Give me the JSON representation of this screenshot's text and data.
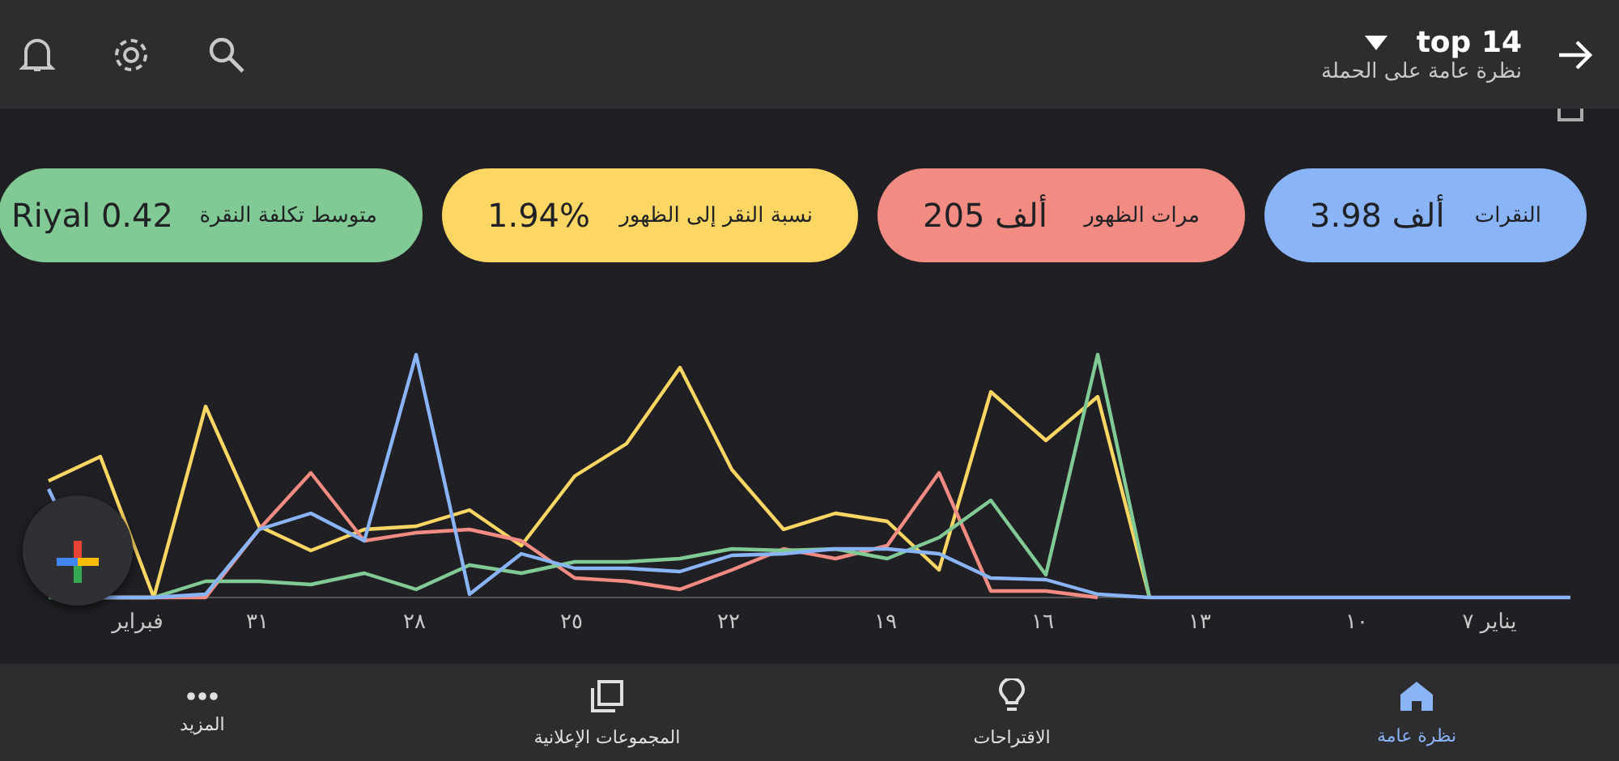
{
  "header": {
    "title": "top 14",
    "subtitle": "نظرة عامة على الحملة"
  },
  "metrics": [
    {
      "label": "النقرات",
      "value": "3.98 ألف",
      "color": "#8ab4f8"
    },
    {
      "label": "مرات الظهور",
      "value": "205 ألف",
      "color": "#f28b82"
    },
    {
      "label": "نسبة النقر إلى الظهور",
      "value": "1.94%",
      "color": "#fdd663"
    },
    {
      "label": "متوسط تكلفة النقرة",
      "value": "Riyal 0.42",
      "color": "#81c995"
    }
  ],
  "x_labels": [
    "يناير ٧",
    "١٠",
    "١٣",
    "١٦",
    "١٩",
    "٢٢",
    "٢٥",
    "٢٨",
    "٣١",
    "فبراير"
  ],
  "nav": [
    {
      "label": "نظرة عامة",
      "kind": "home",
      "selected": true
    },
    {
      "label": "الاقتراحات",
      "kind": "bulb",
      "selected": false
    },
    {
      "label": "المجموعات الإعلانية",
      "kind": "groups",
      "selected": false
    },
    {
      "label": "المزيد",
      "kind": "more",
      "selected": false
    }
  ]
}
